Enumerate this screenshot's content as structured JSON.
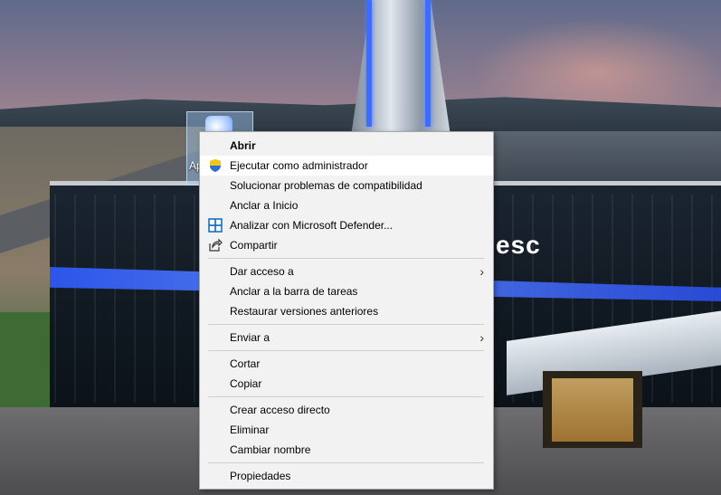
{
  "desktop": {
    "icon": {
      "label": "Ap",
      "icon_name": "application-icon"
    },
    "background_sign_text": "esc"
  },
  "context_menu": {
    "items": [
      {
        "label": "Abrir",
        "bold": true
      },
      {
        "label": "Ejecutar como administrador",
        "icon": "uac-shield-icon",
        "highlighted": true
      },
      {
        "label": "Solucionar problemas de compatibilidad"
      },
      {
        "label": "Anclar a Inicio"
      },
      {
        "label": "Analizar con Microsoft Defender...",
        "icon": "defender-icon"
      },
      {
        "label": "Compartir",
        "icon": "share-icon"
      },
      {
        "label": "Dar acceso a",
        "submenu": true
      },
      {
        "label": "Anclar a la barra de tareas"
      },
      {
        "label": "Restaurar versiones anteriores"
      },
      {
        "label": "Enviar a",
        "submenu": true
      },
      {
        "label": "Cortar"
      },
      {
        "label": "Copiar"
      },
      {
        "label": "Crear acceso directo"
      },
      {
        "label": "Eliminar"
      },
      {
        "label": "Cambiar nombre"
      },
      {
        "label": "Propiedades"
      }
    ],
    "submenu_arrow": "›",
    "colors": {
      "menu_bg": "#f2f2f2",
      "highlight_bg": "#ffffff",
      "border": "#a8a8a8",
      "uac_blue": "#2a6fd6",
      "uac_yellow": "#f5c518",
      "defender_blue": "#0a64c8"
    }
  }
}
